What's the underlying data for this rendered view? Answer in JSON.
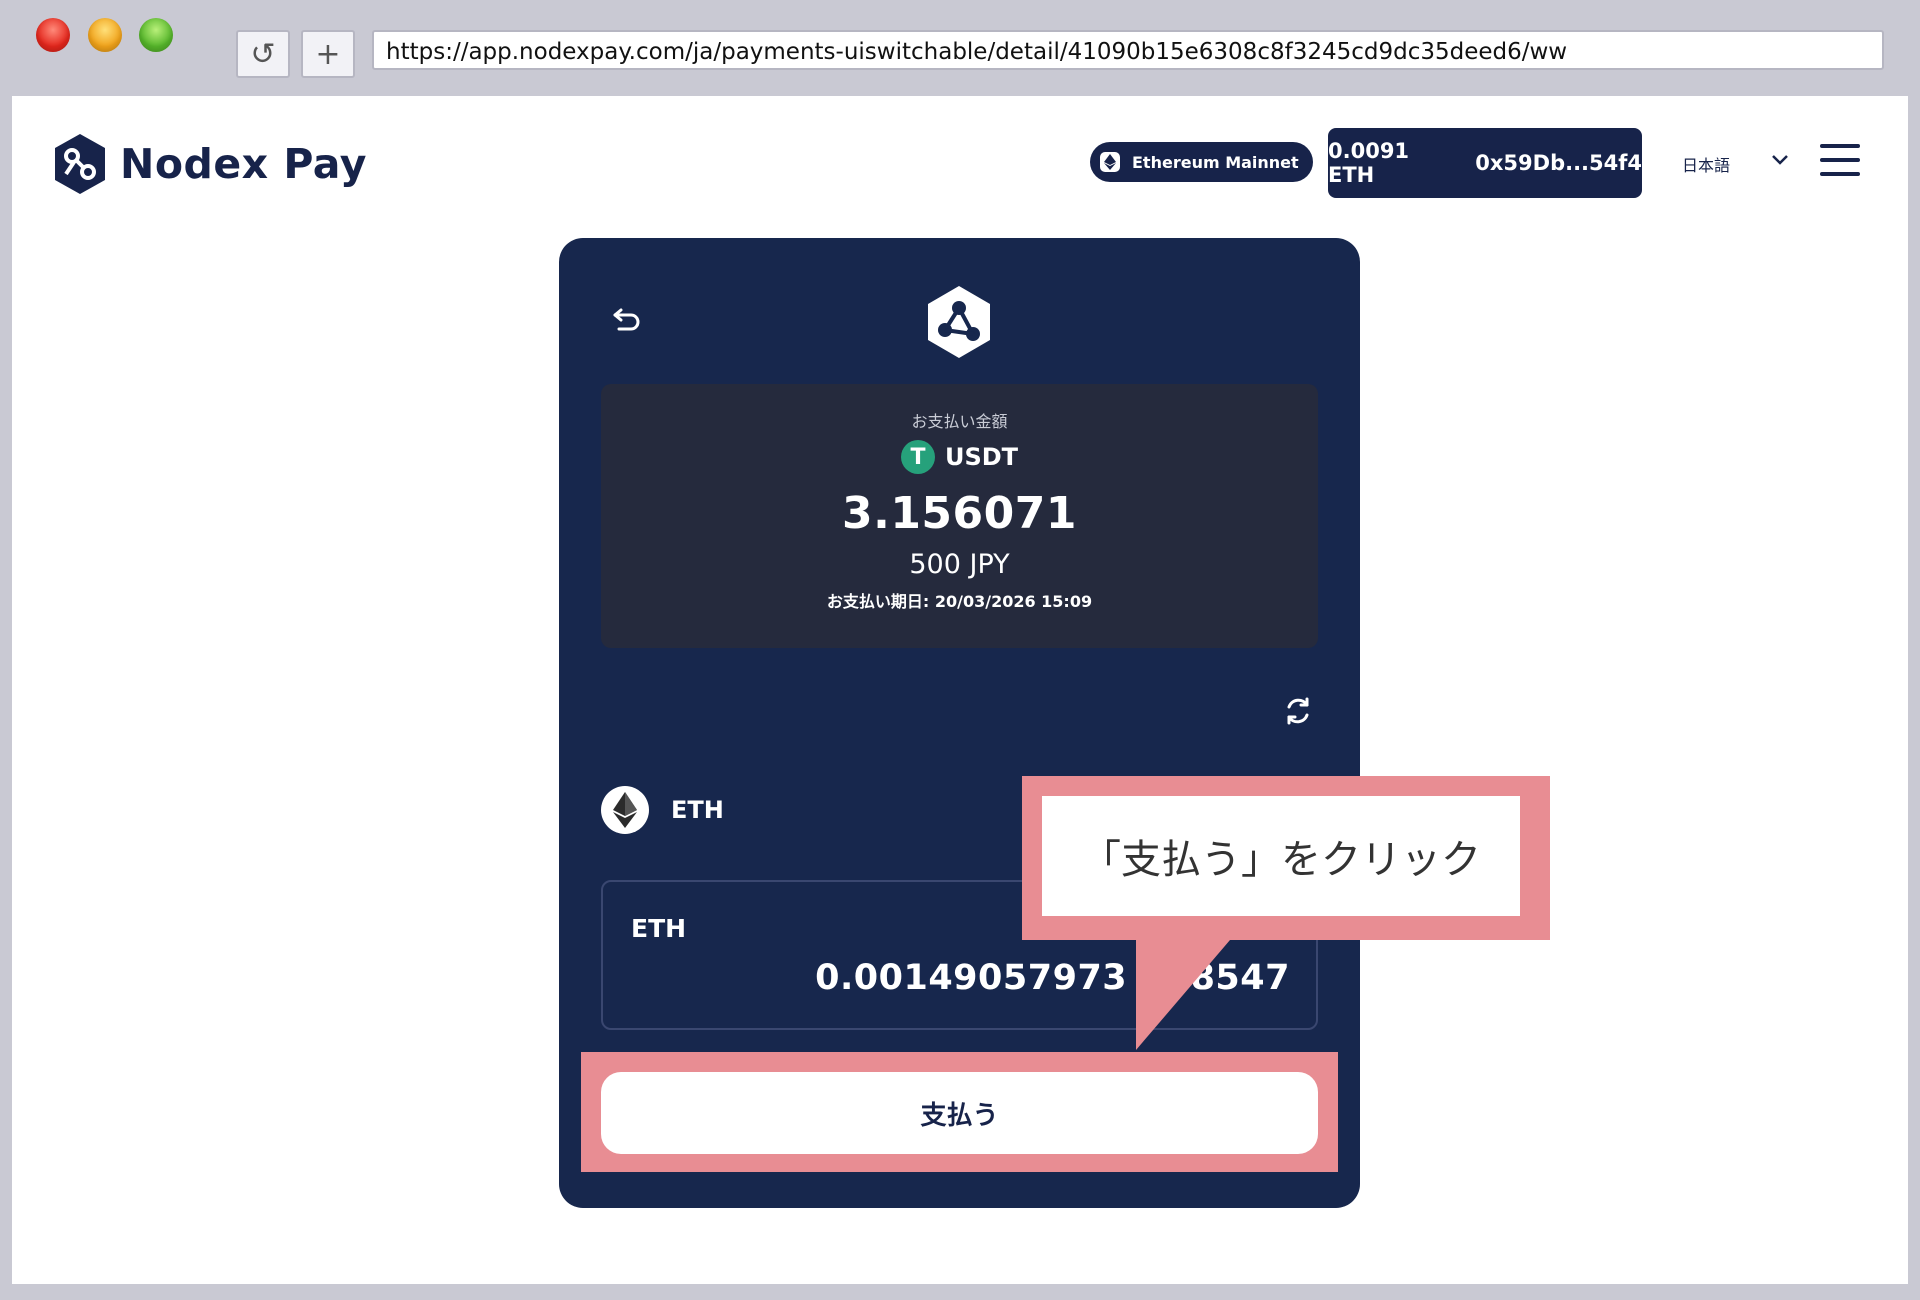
{
  "browser": {
    "url": "https://app.nodexpay.com/ja/payments-uiswitchable/detail/41090b15e6308c8f3245cd9dc35deed6/ww",
    "reload_glyph": "↺",
    "newtab_glyph": "+"
  },
  "header": {
    "brand": "Nodex Pay",
    "network": "Ethereum Mainnet",
    "balance": "0.0091 ETH",
    "address": "0x59Db...54f4",
    "language": "日本語"
  },
  "payment": {
    "amount_label": "お支払い金額",
    "token": "USDT",
    "token_glyph": "T",
    "amount": "3.156071",
    "fiat": "500 JPY",
    "deadline": "お支払い期日: 20/03/2026 15:09"
  },
  "currency": {
    "selected": "ETH",
    "box_label": "ETH",
    "value": "0.00149057973     8547"
  },
  "actions": {
    "pay_label": "支払う"
  },
  "annotation": {
    "text": "「支払う」をクリック"
  },
  "colors": {
    "brand_navy": "#17234a",
    "card_bg": "#17274d",
    "panel_bg": "#252a3d",
    "highlight": "#e88d93",
    "tether_green": "#26a17b"
  }
}
